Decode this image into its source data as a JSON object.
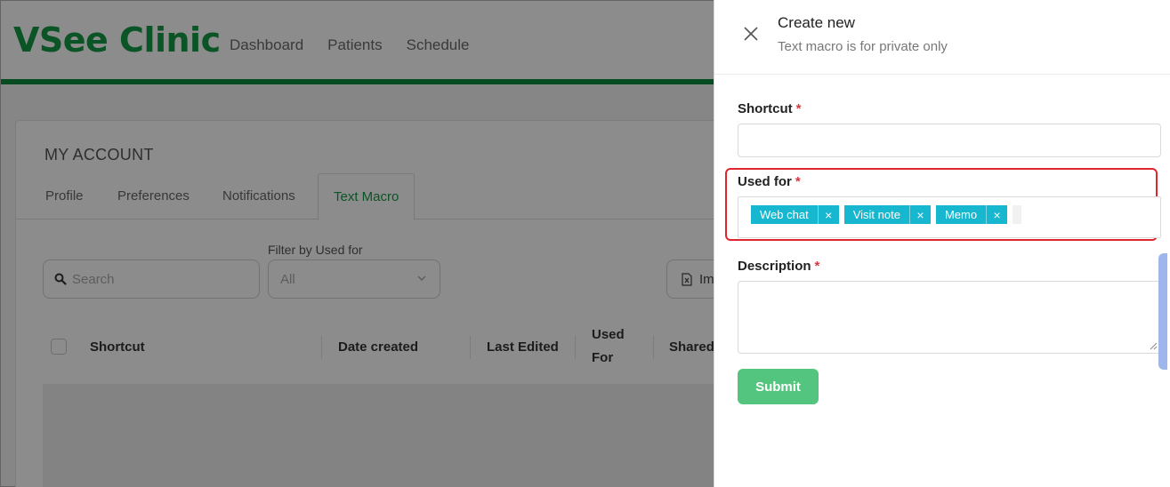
{
  "app": {
    "logo": "VSee Clinic",
    "nav": [
      "Dashboard",
      "Patients",
      "Schedule"
    ]
  },
  "account": {
    "title": "MY ACCOUNT",
    "tabs": [
      "Profile",
      "Preferences",
      "Notifications",
      "Text Macro"
    ],
    "active_tab": "Text Macro"
  },
  "toolbar": {
    "search_placeholder": "Search",
    "filter_label": "Filter by Used for",
    "filter_value": "All",
    "import_label": "Im"
  },
  "table": {
    "headers": {
      "shortcut": "Shortcut",
      "date_created": "Date created",
      "last_edited": "Last Edited",
      "used_for": "Used For",
      "shared": "Shared"
    }
  },
  "drawer": {
    "title": "Create new",
    "subtitle": "Text macro is for private only",
    "shortcut_label": "Shortcut",
    "used_for_label": "Used for",
    "description_label": "Description",
    "required_mark": "*",
    "tags": [
      "Web chat",
      "Visit note",
      "Memo"
    ],
    "tag_remove": "×",
    "submit_label": "Submit"
  },
  "colors": {
    "brand": "#149a44",
    "tag": "#17b7cf",
    "submit": "#53c57e",
    "highlight": "#e0252f"
  },
  "icons": {
    "close": "close-icon",
    "search": "search-icon",
    "chevron": "chevron-down-icon",
    "import": "excel-file-icon",
    "resize": "resize-handle-icon"
  }
}
